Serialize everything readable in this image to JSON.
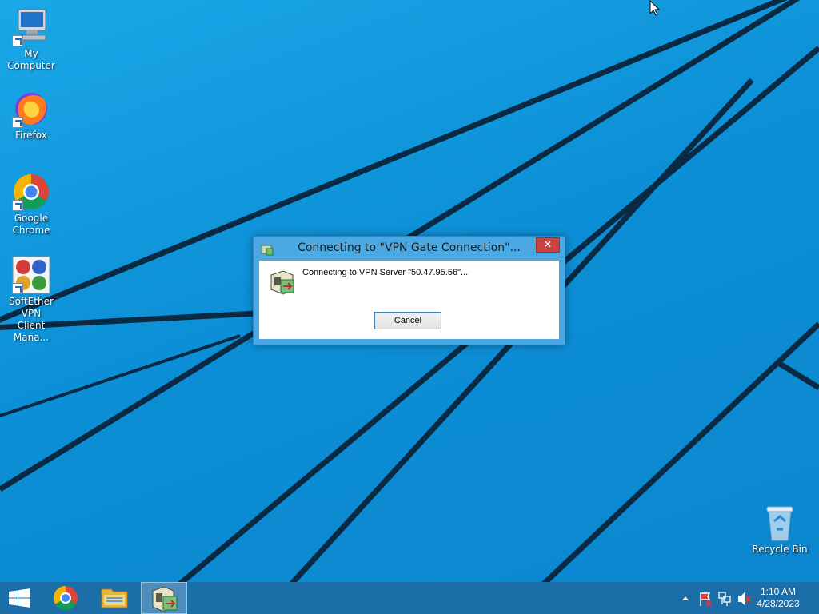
{
  "desktop": {
    "icons": [
      {
        "label": "My Computer",
        "icon": "computer-icon"
      },
      {
        "label": "Firefox",
        "icon": "firefox-icon"
      },
      {
        "label_lines": [
          "Google",
          "Chrome"
        ],
        "icon": "chrome-icon"
      },
      {
        "label_lines": [
          "SoftEther VPN",
          "Client Mana..."
        ],
        "icon": "softether-icon"
      },
      {
        "label": "Recycle Bin",
        "icon": "recycle-bin-icon"
      }
    ]
  },
  "dialog": {
    "title": "Connecting to \"VPN Gate Connection\"...",
    "message": "Connecting to VPN Server \"50.47.95.56\"...",
    "cancel_label": "Cancel",
    "close_glyph": "✕"
  },
  "taskbar": {
    "buttons": [
      {
        "icon": "windows-start-icon"
      },
      {
        "icon": "chrome-icon"
      },
      {
        "icon": "file-explorer-icon"
      },
      {
        "icon": "softether-icon",
        "active": true
      }
    ],
    "tray": {
      "icons": [
        "show-hidden-icons-icon",
        "action-center-flag-icon",
        "network-icon",
        "volume-muted-icon"
      ],
      "time": "1:10 AM",
      "date": "4/28/2023"
    }
  },
  "colors": {
    "wallpaper": "#0c8fd6",
    "taskbar": "#1b6ea8",
    "dialog_frame": "#4aa9e3",
    "close_button": "#c7453e"
  }
}
